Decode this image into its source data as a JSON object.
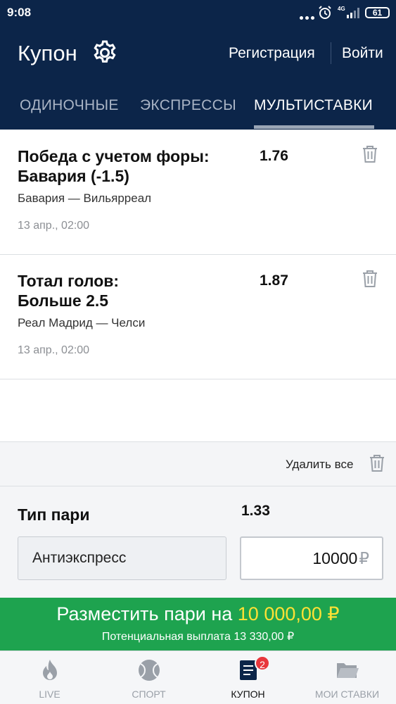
{
  "status_bar": {
    "time": "9:08",
    "network": "4G",
    "battery": "61"
  },
  "header": {
    "title": "Купон",
    "register_label": "Регистрация",
    "login_label": "Войти"
  },
  "tabs": [
    {
      "label": "ОДИНОЧНЫЕ",
      "active": false
    },
    {
      "label": "ЭКСПРЕССЫ",
      "active": false
    },
    {
      "label": "МУЛЬТИСТАВКИ",
      "active": true
    }
  ],
  "bets": [
    {
      "market_line1": "Победа с учетом форы:",
      "market_line2": "Бавария (-1.5)",
      "odds": "1.76",
      "match": "Бавария — Вильярреал",
      "date": "13 апр., 02:00"
    },
    {
      "market_line1": "Тотал голов:",
      "market_line2": "Больше 2.5",
      "odds": "1.87",
      "match": "Реал Мадрид — Челси",
      "date": "13 апр., 02:00"
    }
  ],
  "coupon": {
    "delete_all_label": "Удалить все",
    "bet_type_label": "Тип пари",
    "total_odds": "1.33",
    "bet_type_value": "Антиэкспресс",
    "amount_value": "10000",
    "currency": "₽"
  },
  "place_button": {
    "label_prefix": "Разместить пари на",
    "amount": "10 000,00 ₽",
    "potential_payout": "Потенциальная выплата 13 330,00 ₽"
  },
  "bottom_nav": [
    {
      "label": "LIVE",
      "icon": "fire-icon",
      "active": false
    },
    {
      "label": "СПОРТ",
      "icon": "tennis-ball-icon",
      "active": false
    },
    {
      "label": "КУПОН",
      "icon": "coupon-icon",
      "active": true,
      "badge": "2"
    },
    {
      "label": "МОИ СТАВКИ",
      "icon": "folder-icon",
      "active": false
    }
  ],
  "colors": {
    "header_bg": "#0c2549",
    "place_button_bg": "#1ea34f",
    "amount_highlight": "#ffe135",
    "badge": "#e8363c"
  }
}
